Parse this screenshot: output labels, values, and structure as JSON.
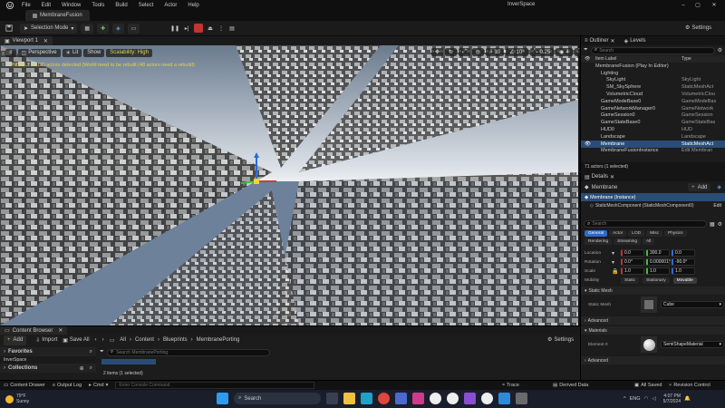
{
  "app": {
    "title": "InverSpace",
    "tab": "MembraneFusion",
    "menu": [
      "File",
      "Edit",
      "Window",
      "Tools",
      "Build",
      "Select",
      "Actor",
      "Help"
    ],
    "settings_label": "Settings"
  },
  "toolbar": {
    "selection_mode": "Selection Mode"
  },
  "viewport": {
    "tab": "Viewport 1",
    "perspective": "Perspective",
    "lit": "Lit",
    "show": "Show",
    "scalability": "Scalability: High",
    "warning": "UNBUILT HLOD actors detected (World need to be rebuilt (48 actors need a rebuild)",
    "grid_value": "10",
    "rot_value": "10°",
    "scale_value": "0.25",
    "cam_speed": "4"
  },
  "content_browser": {
    "tab": "Content Browser",
    "add_label": "Add",
    "import_label": "Import",
    "save_all_label": "Save All",
    "breadcrumb": [
      "All",
      "Content",
      "Blueprints",
      "MembranePorting"
    ],
    "settings_label": "Settings",
    "favorites_label": "Favorites",
    "project_label": "InverSpace",
    "collections_label": "Collections",
    "search_placeholder": "Search MembranePorting",
    "items_count": "2 items (1 selected)"
  },
  "outliner": {
    "tab": "Outliner",
    "tab2": "Levels",
    "search_placeholder": "Search",
    "col_label": "Item Label",
    "col_type": "Type",
    "rows": [
      {
        "label": "MembraneFusion (Play In Editor)",
        "type": ""
      },
      {
        "label": "Lighting",
        "type": ""
      },
      {
        "label": "SkyLight",
        "type": "SkyLight"
      },
      {
        "label": "SM_SkySphere",
        "type": "StaticMeshAct"
      },
      {
        "label": "VolumetricCloud",
        "type": "VolumetricClou"
      },
      {
        "label": "GameModeBase0",
        "type": "GameModeBas"
      },
      {
        "label": "GameNetworkManager0",
        "type": "GameNetwork"
      },
      {
        "label": "GameSession0",
        "type": "GameSession"
      },
      {
        "label": "GameStateBase0",
        "type": "GameStateBas"
      },
      {
        "label": "HUD0",
        "type": "HUD"
      },
      {
        "label": "Landscape",
        "type": "Landscape"
      },
      {
        "label": "Membrane",
        "type": "StaticMeshAct"
      },
      {
        "label": "MembraneFusionInstance",
        "type": "Edit Membran"
      }
    ],
    "selected_index": 11,
    "footer": "71 actors (1 selected)"
  },
  "details": {
    "tab": "Details",
    "actor_name": "Membrane",
    "add_label": "Add",
    "instance_label": "Membrane (Instance)",
    "component_label": "StaticMeshComponent (StaticMeshComponent0)",
    "edit_label": "Edit",
    "search_placeholder": "Search",
    "filter_tabs_row1": [
      "General",
      "Actor",
      "LOD",
      "Misc",
      "Physics"
    ],
    "filter_tabs_row2": [
      "Rendering",
      "Streaming",
      "All"
    ],
    "location_label": "Location",
    "rotation_label": "Rotation",
    "scale_label": "Scale",
    "location": [
      "0.0",
      "300.0",
      "0.0"
    ],
    "rotation": [
      "0.0°",
      "0.000001°",
      "-90.0°"
    ],
    "scale": [
      "1.0",
      "1.0",
      "1.0"
    ],
    "mobility_label": "Mobility",
    "mobility_options": [
      "Static",
      "Stationary",
      "Movable"
    ],
    "static_mesh_section": "Static Mesh",
    "static_mesh_label": "Static Mesh",
    "static_mesh_value": "Cube",
    "advanced_label": "Advanced",
    "materials_section": "Materials",
    "element_label": "Element 0",
    "material_value": "SemiShapeMaterial"
  },
  "statusbar": {
    "content_drawer": "Content Drawer",
    "output_log": "Output Log",
    "cmd": "Cmd",
    "console_placeholder": "Enter Console Command",
    "trace": "Trace",
    "derived_data": "Derived Data",
    "all_saved": "All Saved",
    "revision_control": "Revision Control"
  },
  "taskbar": {
    "weather_temp": "79°F",
    "weather_desc": "Sunny",
    "search_label": "Search",
    "lang": "ENG",
    "time": "4:07 PM",
    "date": "5/7/2024"
  },
  "colors": {
    "accent": "#2d6bc4",
    "selection": "#2a4d78",
    "warning": "#e0d44a"
  }
}
